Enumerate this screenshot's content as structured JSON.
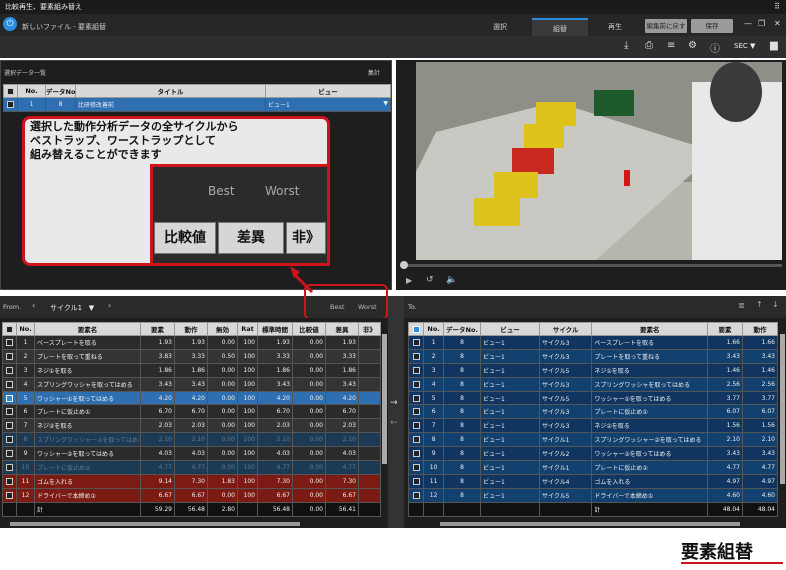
{
  "window": {
    "title": "比較再生、要素組み替え"
  },
  "app": {
    "file_title": "新しいファイル - 要素組替"
  },
  "tabs": [
    {
      "label": "選択"
    },
    {
      "label": "組替"
    },
    {
      "label": "再生"
    }
  ],
  "buttons": {
    "revert": "編集前に戻す",
    "save": "保存"
  },
  "toolbar": {
    "unit": "SEC"
  },
  "selection_panel": {
    "title": "選択データ一覧",
    "aggregate": "集計",
    "headers": [
      "No.",
      "データNo.",
      "タイトル",
      "ビュー"
    ],
    "row": {
      "no": "1",
      "data_no": "8",
      "title": "比研修改善前",
      "view": "ビュー1"
    }
  },
  "callout": {
    "text1": "選択した動作分析データの全サイクルから",
    "text2": "ベストラップ、ワーストラップとして",
    "text3": "組み替えることができます",
    "zoom_best": "Best",
    "zoom_worst": "Worst",
    "zoom_btn1": "比較値",
    "zoom_btn2": "差異",
    "zoom_btn3": "非》"
  },
  "from_bar": {
    "label": "From.",
    "cycle": "サイクル1",
    "best": "Best",
    "worst": "Worst"
  },
  "to_bar": {
    "label": "To."
  },
  "left_table": {
    "headers": [
      "No.",
      "要素名",
      "要素",
      "動作",
      "無効",
      "Rat",
      "標準時間",
      "比較値",
      "差異",
      "非》"
    ],
    "rows": [
      {
        "no": "1",
        "name": "ベースプレートを取る",
        "v": [
          "1.93",
          "1.93",
          "0.00",
          "100",
          "1.93",
          "0.00",
          "1.93"
        ]
      },
      {
        "no": "2",
        "name": "プレートを取って重ねる",
        "v": [
          "3.83",
          "3.33",
          "0.50",
          "100",
          "3.33",
          "0.00",
          "3.33"
        ]
      },
      {
        "no": "3",
        "name": "ネジ①を取る",
        "v": [
          "1.86",
          "1.86",
          "0.00",
          "100",
          "1.86",
          "0.00",
          "1.86"
        ]
      },
      {
        "no": "4",
        "name": "スプリングワッシャを取ってはめる",
        "v": [
          "3.43",
          "3.43",
          "0.00",
          "100",
          "3.43",
          "0.00",
          "3.43"
        ]
      },
      {
        "no": "5",
        "name": "ワッシャー①を取ってはめる",
        "v": [
          "4.20",
          "4.20",
          "0.00",
          "100",
          "4.20",
          "0.00",
          "4.20"
        ]
      },
      {
        "no": "6",
        "name": "プレートに仮止め①",
        "v": [
          "6.70",
          "6.70",
          "0.00",
          "100",
          "6.70",
          "0.00",
          "6.70"
        ]
      },
      {
        "no": "7",
        "name": "ネジ②を取る",
        "v": [
          "2.03",
          "2.03",
          "0.00",
          "100",
          "2.03",
          "0.00",
          "2.03"
        ]
      },
      {
        "no": "8",
        "name": "スプリングワッシャー②を取ってはめる",
        "v": [
          "2.10",
          "2.10",
          "0.00",
          "100",
          "2.10",
          "0.00",
          "2.10"
        ]
      },
      {
        "no": "9",
        "name": "ワッシャー②を取ってはめる",
        "v": [
          "4.03",
          "4.03",
          "0.00",
          "100",
          "4.03",
          "0.00",
          "4.03"
        ]
      },
      {
        "no": "10",
        "name": "プレートに仮止め②",
        "v": [
          "4.77",
          "4.77",
          "0.00",
          "100",
          "4.77",
          "0.00",
          "4.77"
        ]
      },
      {
        "no": "11",
        "name": "ゴムを入れる",
        "v": [
          "9.14",
          "7.30",
          "1.83",
          "100",
          "7.30",
          "0.00",
          "7.30"
        ]
      },
      {
        "no": "12",
        "name": "ドライバーで本締め①",
        "v": [
          "6.67",
          "6.67",
          "0.00",
          "100",
          "6.67",
          "0.00",
          "6.67"
        ]
      }
    ],
    "sum": {
      "label": "計",
      "v": [
        "59.29",
        "56.48",
        "2.80",
        "",
        "56.48",
        "0.00",
        "56.41"
      ]
    }
  },
  "right_table": {
    "headers": [
      "No.",
      "データNo.",
      "ビュー",
      "サイクル",
      "要素名",
      "要素",
      "動作"
    ],
    "rows": [
      {
        "no": "1",
        "data": "8",
        "view": "ビュー1",
        "cycle": "サイクル3",
        "name": "ベースプレートを取る",
        "e": "1.66",
        "m": "1.66"
      },
      {
        "no": "2",
        "data": "8",
        "view": "ビュー1",
        "cycle": "サイクル3",
        "name": "プレートを取って重ねる",
        "e": "3.43",
        "m": "3.43"
      },
      {
        "no": "3",
        "data": "8",
        "view": "ビュー1",
        "cycle": "サイクル5",
        "name": "ネジ①を取る",
        "e": "1.46",
        "m": "1.46"
      },
      {
        "no": "4",
        "data": "8",
        "view": "ビュー1",
        "cycle": "サイクル3",
        "name": "スプリングワッシャを取ってはめる",
        "e": "2.56",
        "m": "2.56"
      },
      {
        "no": "5",
        "data": "8",
        "view": "ビュー1",
        "cycle": "サイクル5",
        "name": "ワッシャー①を取ってはめる",
        "e": "3.77",
        "m": "3.77"
      },
      {
        "no": "6",
        "data": "8",
        "view": "ビュー1",
        "cycle": "サイクル3",
        "name": "プレートに仮止め①",
        "e": "6.07",
        "m": "6.07"
      },
      {
        "no": "7",
        "data": "8",
        "view": "ビュー1",
        "cycle": "サイクル3",
        "name": "ネジ②を取る",
        "e": "1.56",
        "m": "1.56"
      },
      {
        "no": "8",
        "data": "8",
        "view": "ビュー1",
        "cycle": "サイクル1",
        "name": "スプリングワッシャー②を取ってはめる",
        "e": "2.10",
        "m": "2.10"
      },
      {
        "no": "9",
        "data": "8",
        "view": "ビュー1",
        "cycle": "サイクル2",
        "name": "ワッシャー②を取ってはめる",
        "e": "3.43",
        "m": "3.43"
      },
      {
        "no": "10",
        "data": "8",
        "view": "ビュー1",
        "cycle": "サイクル1",
        "name": "プレートに仮止め②",
        "e": "4.77",
        "m": "4.77"
      },
      {
        "no": "11",
        "data": "8",
        "view": "ビュー1",
        "cycle": "サイクル4",
        "name": "ゴムを入れる",
        "e": "4.97",
        "m": "4.97"
      },
      {
        "no": "12",
        "data": "8",
        "view": "ビュー1",
        "cycle": "サイクル5",
        "name": "ドライバーで本締め①",
        "e": "4.60",
        "m": "4.60"
      }
    ],
    "sum": {
      "label": "計",
      "e": "48.04",
      "m": "48.04"
    }
  },
  "caption": "要素組替"
}
